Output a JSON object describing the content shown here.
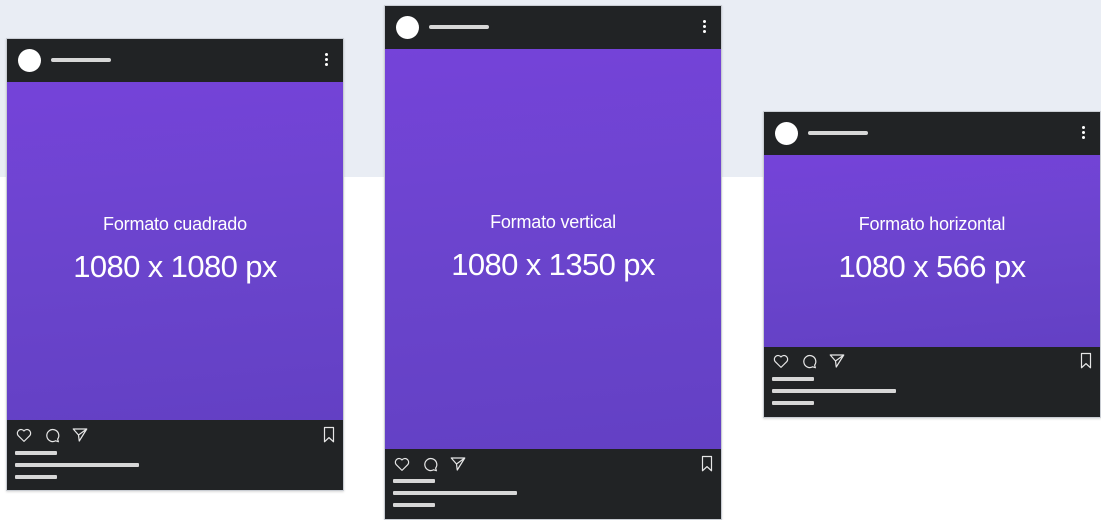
{
  "posts": [
    {
      "id": "square",
      "format_label": "Formato cuadrado",
      "dimensions_label": "1080 x 1080 px"
    },
    {
      "id": "vertical",
      "format_label": "Formato vertical",
      "dimensions_label": "1080 x 1350 px"
    },
    {
      "id": "horizontal",
      "format_label": "Formato horizontal",
      "dimensions_label": "1080 x 566 px"
    }
  ],
  "colors": {
    "background_band": "#e9edf4",
    "post_frame": "#212325",
    "image_purple": "#6f44d3",
    "placeholder_line": "#d7d7d7"
  },
  "icons": [
    "avatar",
    "more-vertical-icon",
    "heart-icon",
    "comment-icon",
    "send-icon",
    "bookmark-icon"
  ]
}
